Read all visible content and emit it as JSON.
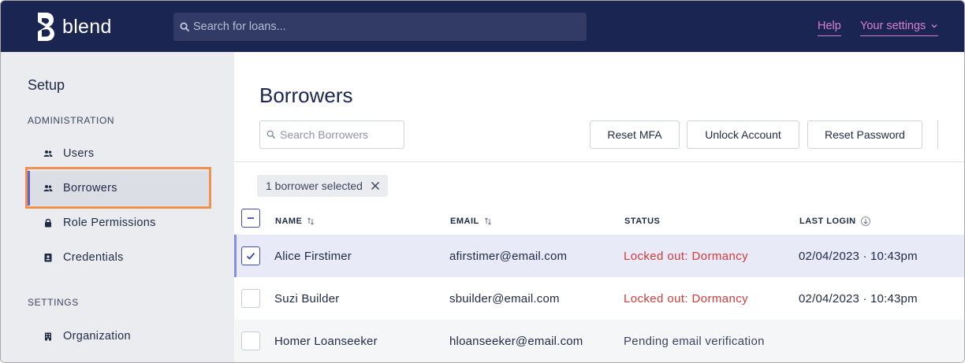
{
  "app": {
    "brand": "blend"
  },
  "topbar": {
    "search_placeholder": "Search for loans...",
    "help_label": "Help",
    "settings_label": "Your settings",
    "accent_color": "#d77fcf"
  },
  "sidebar": {
    "title": "Setup",
    "sections": [
      {
        "label": "ADMINISTRATION"
      },
      {
        "label": "SETTINGS"
      }
    ],
    "items": [
      {
        "label": "Users",
        "icon": "users-icon"
      },
      {
        "label": "Borrowers",
        "icon": "users-icon",
        "active": true
      },
      {
        "label": "Role Permissions",
        "icon": "lock-icon"
      },
      {
        "label": "Credentials",
        "icon": "id-badge-icon"
      },
      {
        "label": "Organization",
        "icon": "building-icon"
      }
    ]
  },
  "main": {
    "title": "Borrowers",
    "search_placeholder": "Search Borrowers",
    "actions": {
      "reset_mfa": "Reset MFA",
      "unlock_account": "Unlock Account",
      "reset_password": "Reset Password"
    },
    "selection_chip": "1 borrower selected",
    "columns": {
      "name": "NAME",
      "email": "EMAIL",
      "status": "STATUS",
      "last_login": "LAST LOGIN"
    },
    "rows": [
      {
        "name": "Alice Firstimer",
        "email": "afirstimer@email.com",
        "status": "Locked out: Dormancy",
        "last_login": "02/04/2023 · 10:43pm",
        "selected": true
      },
      {
        "name": "Suzi Builder",
        "email": "sbuilder@email.com",
        "status": "Locked out: Dormancy",
        "last_login": "02/04/2023 · 10:43pm",
        "selected": false
      },
      {
        "name": "Homer Loanseeker",
        "email": "hloanseeker@email.com",
        "status": "Pending email verification",
        "last_login": "",
        "selected": false
      }
    ]
  },
  "colors": {
    "navy": "#1b2552",
    "locked": "#d33a3a",
    "highlight": "#f0904f",
    "selected_row": "#e9eaf8"
  }
}
